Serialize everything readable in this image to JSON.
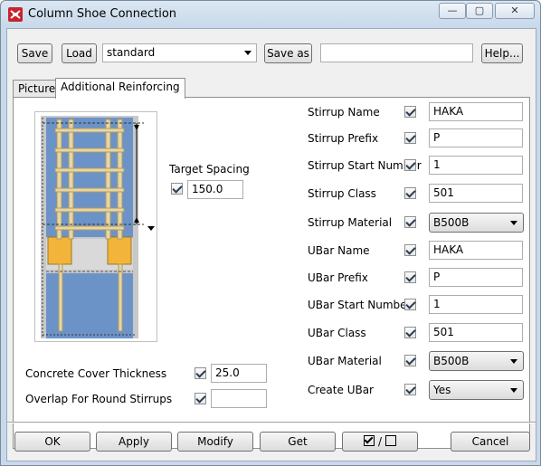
{
  "window": {
    "title": "Column Shoe Connection",
    "controls": {
      "minimize": "—",
      "maximize": "▢",
      "close": "✕"
    }
  },
  "toolbar": {
    "save_label": "Save",
    "load_label": "Load",
    "preset_value": "standard",
    "save_as_label": "Save as",
    "save_as_value": "",
    "help_label": "Help..."
  },
  "tabs": [
    {
      "label": "Picture",
      "active": false
    },
    {
      "label": "Additional Reinforcing",
      "active": true
    }
  ],
  "left": {
    "target_spacing_label": "Target Spacing",
    "target_spacing_value": "150.0",
    "concrete_cover_label": "Concrete Cover Thickness",
    "concrete_cover_value": "25.0",
    "overlap_label": "Overlap For Round Stirrups",
    "overlap_value": ""
  },
  "fields": [
    {
      "label": "Stirrup Name",
      "value": "HAKA",
      "type": "text"
    },
    {
      "label": "Stirrup Prefix",
      "value": "P",
      "type": "text"
    },
    {
      "label": "Stirrup Start Number",
      "value": "1",
      "type": "text"
    },
    {
      "label": "Stirrup Class",
      "value": "501",
      "type": "text"
    },
    {
      "label": "Stirrup Material",
      "value": "B500B",
      "type": "select"
    },
    {
      "label": "UBar Name",
      "value": "HAKA",
      "type": "text"
    },
    {
      "label": "UBar Prefix",
      "value": "P",
      "type": "text"
    },
    {
      "label": "UBar Start Number",
      "value": "1",
      "type": "text"
    },
    {
      "label": "UBar Class",
      "value": "501",
      "type": "text"
    },
    {
      "label": "UBar Material",
      "value": "B500B",
      "type": "select"
    },
    {
      "label": "Create UBar",
      "value": "Yes",
      "type": "select"
    }
  ],
  "footer": {
    "ok_label": "OK",
    "apply_label": "Apply",
    "modify_label": "Modify",
    "get_label": "Get",
    "toggle_label": "/",
    "cancel_label": "Cancel"
  },
  "colors": {
    "concrete_blue": "#6b93c8",
    "plate_orange": "#f2b43a",
    "rebar_tan": "#e6d6a6"
  }
}
